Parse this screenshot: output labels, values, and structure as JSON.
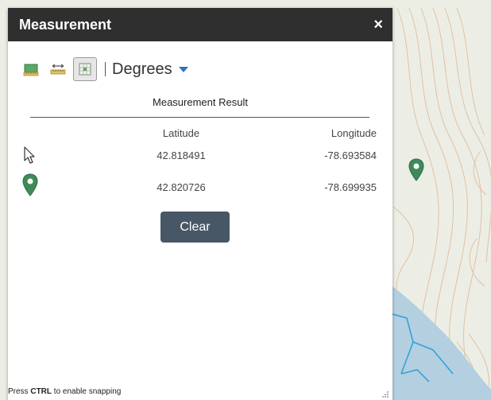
{
  "panel": {
    "title": "Measurement",
    "close_label": "×"
  },
  "toolbar": {
    "tools": [
      {
        "name": "area-tool-icon",
        "active": false
      },
      {
        "name": "distance-tool-icon",
        "active": false
      },
      {
        "name": "location-tool-icon",
        "active": true
      }
    ],
    "unit": "Degrees"
  },
  "result": {
    "title": "Measurement Result",
    "headers": {
      "latitude": "Latitude",
      "longitude": "Longitude"
    },
    "rows": [
      {
        "icon": "cursor-icon",
        "latitude": "42.818491",
        "longitude": "-78.693584"
      },
      {
        "icon": "map-pin-icon",
        "latitude": "42.820726",
        "longitude": "-78.699935"
      }
    ]
  },
  "clear_label": "Clear",
  "hint": {
    "prefix": "Press ",
    "key": "CTRL",
    "suffix": " to enable snapping"
  },
  "colors": {
    "header_bg": "#2f2f2f",
    "clear_bg": "#485766",
    "pin": "#3f8a5a",
    "water": "#b3cfe0",
    "contour": "#e0b89a"
  }
}
